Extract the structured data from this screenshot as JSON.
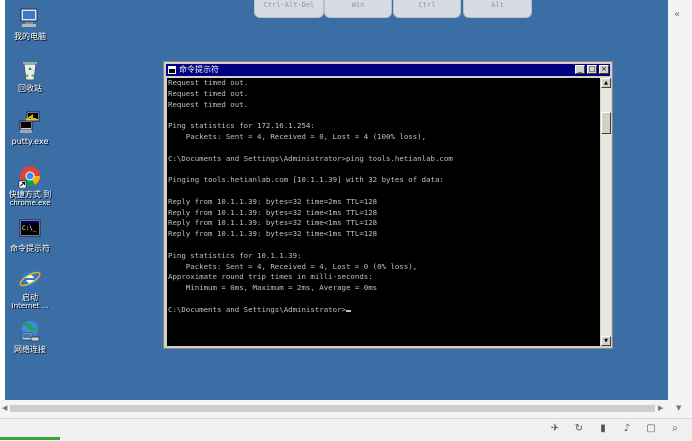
{
  "keys": [
    "Ctrl-Alt-Del",
    "Win",
    "Ctrl",
    "Alt"
  ],
  "desktop_icons": [
    {
      "label": "我的电脑",
      "icon": "my-computer-icon"
    },
    {
      "label": "回收站",
      "icon": "recycle-bin-icon"
    },
    {
      "label": "putty.exe",
      "icon": "putty-icon"
    },
    {
      "label": "快捷方式 到",
      "label2": "chrome.exe",
      "icon": "chrome-icon"
    },
    {
      "label": "命令提示符",
      "icon": "cmd-icon"
    },
    {
      "label": "启动",
      "label2": "Internet ...",
      "icon": "internet-explorer-icon"
    },
    {
      "label": "网络连接",
      "icon": "network-connections-icon"
    }
  ],
  "window": {
    "title": "命令提示符",
    "console_text": "Request timed out.\nRequest timed out.\nRequest timed out.\n\nPing statistics for 172.16.1.254:\n    Packets: Sent = 4, Received = 0, Lost = 4 (100% loss),\n\nC:\\Documents and Settings\\Administrator>ping tools.hetianlab.com\n\nPinging tools.hetianlab.com [10.1.1.39] with 32 bytes of data:\n\nReply from 10.1.1.39: bytes=32 time=2ms TTL=128\nReply from 10.1.1.39: bytes=32 time<1ms TTL=128\nReply from 10.1.1.39: bytes=32 time<1ms TTL=128\nReply from 10.1.1.39: bytes=32 time<1ms TTL=128\n\nPing statistics for 10.1.1.39:\n    Packets: Sent = 4, Received = 4, Lost = 0 (0% loss),\nApproximate round trip times in milli-seconds:\n    Minimum = 0ms, Maximum = 2ms, Average = 0ms\n\nC:\\Documents and Settings\\Administrator>"
  },
  "colors": {
    "desktop": "#3a6ea5",
    "titlebar": "#000080",
    "console_bg": "#000000",
    "console_fg": "#c0c0c0"
  }
}
